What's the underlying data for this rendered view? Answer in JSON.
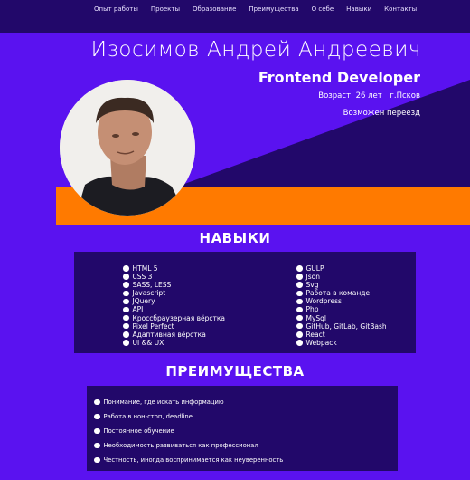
{
  "nav": {
    "items": [
      "Опыт работы",
      "Проекты",
      "Образование",
      "Преимущества",
      "О себе",
      "Навыки",
      "Контакты"
    ]
  },
  "hero": {
    "name": "Изосимов Андрей Андреевич",
    "role": "Frontend Developer",
    "age": "Возраст: 26 лет",
    "city": "г.Псков",
    "relocate": "Возможен переезд"
  },
  "skills": {
    "title": "НАВЫКИ",
    "left": [
      "HTML 5",
      "CSS 3",
      "SASS, LESS",
      "Javascript",
      "JQuery",
      "API",
      "Кроссбраузерная вёрстка",
      "Pixel Perfect",
      "Адаптивная вёрстка",
      "UI && UX"
    ],
    "right": [
      "GULP",
      "Json",
      "Svg",
      "Работа в команде",
      "Wordpress",
      "Php",
      "MySql",
      "GitHub, GitLab, GitBash",
      "React",
      "Webpack"
    ]
  },
  "advantages": {
    "title": "ПРЕИМУЩЕСТВА",
    "items": [
      "Понимание, где искать информацию",
      "Работа в нон-стоп, deadline",
      "Постоянное обучение",
      "Необходимость развиваться как профессионал",
      "Честность, иногда воспринимается как неуверенность"
    ]
  },
  "colors": {
    "background": "#5a12f0",
    "dark": "#22086a",
    "accent": "#ff7a00"
  }
}
